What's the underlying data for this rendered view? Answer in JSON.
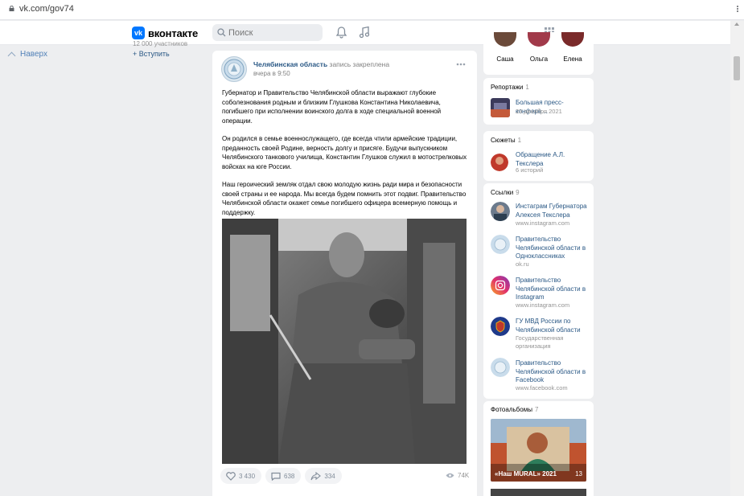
{
  "browser": {
    "url": "vk.com/gov74"
  },
  "header": {
    "logo_letter": "vk",
    "logo_text": "вконтакте",
    "search_placeholder": "Поиск"
  },
  "left": {
    "up_label": "Наверх",
    "group_members": "12 000 участников",
    "join_label": "+ Вступить"
  },
  "post": {
    "author": "Челябинская область",
    "author_note": "запись закреплена",
    "time": "вчера в 9:50",
    "paragraphs": [
      "Губернатор и Правительство Челябинской области выражают глубокие соболезнования родным и близким Глушкова Константина Николаевича, погибшего при исполнении воинского долга в ходе специальной военной операции.",
      "Он родился в семье военнослужащего, где всегда чтили армейские традиции, преданность своей Родине, верность долгу и присяге. Будучи выпускником Челябинского танкового училища, Константин Глушков служил в мотострелковых войсках на юге России.",
      "Наш героический земляк отдал свою молодую жизнь ради мира и безопасности своей страны и ее народа. Мы всегда будем помнить этот подвиг. Правительство Челябинской области окажет семье погибшего офицера всемерную помощь и поддержку."
    ],
    "likes": "3 430",
    "comments": "638",
    "shares": "334",
    "views": "74K"
  },
  "sidebar": {
    "friends": [
      {
        "name": "Саша",
        "color": "#6b4a3a"
      },
      {
        "name": "Ольга",
        "color": "#a13a4a"
      },
      {
        "name": "Елена",
        "color": "#7a2a2a"
      }
    ],
    "reports": {
      "title": "Репортажи",
      "count": "1",
      "item_title": "Большая пресс-конфере…",
      "item_date": "23 декабря 2021"
    },
    "stories": {
      "title": "Сюжеты",
      "count": "1",
      "item_title": "Обращение А.Л. Текслера",
      "item_sub": "6 историй"
    },
    "links": {
      "title": "Ссылки",
      "count": "9",
      "items": [
        {
          "title": "Инстаграм Губернатора Алексея Текслера",
          "sub": "www.instagram.com"
        },
        {
          "title": "Правительство Челябинской области в Одноклассниках",
          "sub": "ok.ru"
        },
        {
          "title": "Правительство Челябинской области в Instagram",
          "sub": "www.instagram.com"
        },
        {
          "title": "ГУ МВД России по Челябинской области",
          "sub": "Государственная организация"
        },
        {
          "title": "Правительство Челябинской области в Facebook",
          "sub": "www.facebook.com"
        }
      ]
    },
    "albums": {
      "title": "Фотоальбомы",
      "count": "7",
      "first_label": "«Наш MURAL» 2021",
      "first_count": "13"
    }
  }
}
